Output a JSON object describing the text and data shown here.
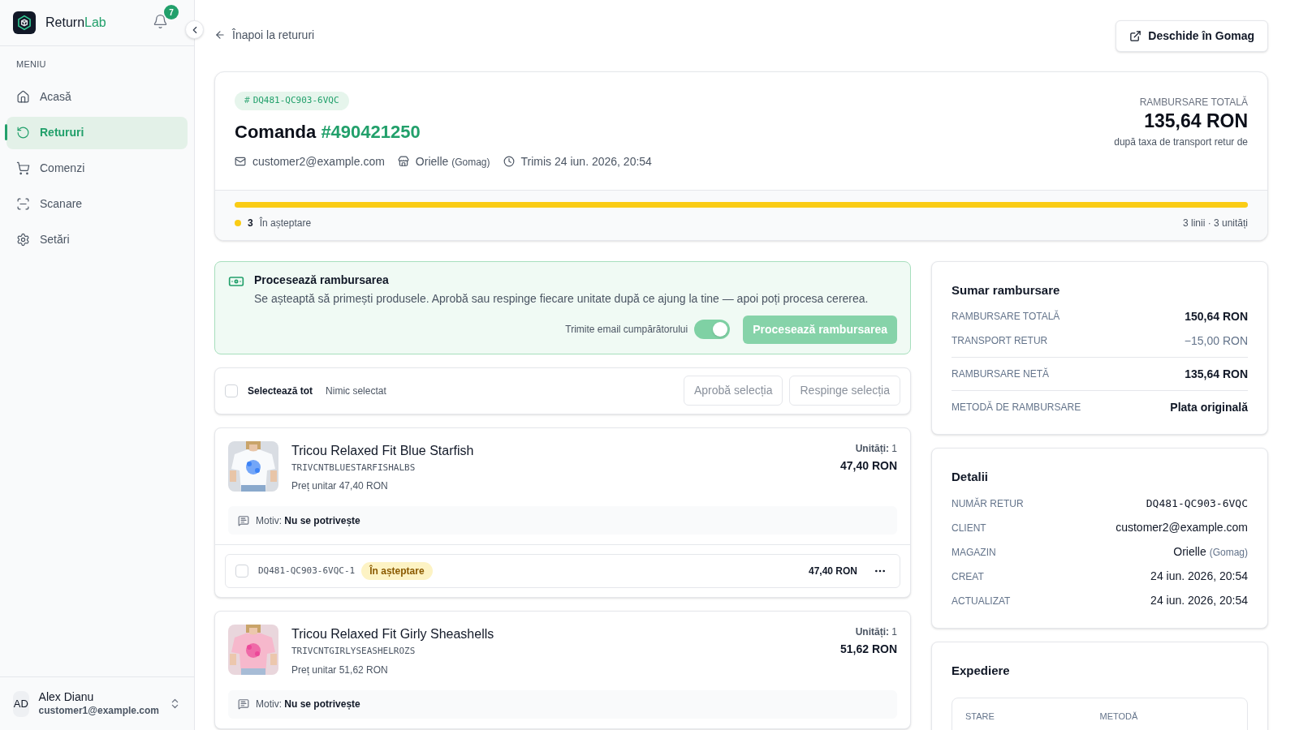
{
  "sidebar": {
    "brand": {
      "main": "Return",
      "accent": "Lab"
    },
    "notifications": {
      "count": "7"
    },
    "section_label": "MENIU",
    "items": [
      {
        "label": "Acasă",
        "selected": false
      },
      {
        "label": "Retururi",
        "selected": true
      },
      {
        "label": "Comenzi",
        "selected": false
      },
      {
        "label": "Scanare",
        "selected": false
      },
      {
        "label": "Setări",
        "selected": false
      }
    ],
    "user": {
      "initials": "AD",
      "name": "Alex Dianu",
      "email": "customer1@example.com"
    }
  },
  "header": {
    "back_link": "Înapoi la retururi",
    "open_button": "Deschide în Gomag"
  },
  "order": {
    "hash_sign": "#",
    "return_code": "DQ481-QC903-6VQC",
    "title_prefix": "Comanda",
    "order_number": "#490421250",
    "email": "customer2@example.com",
    "store": "Orielle",
    "platform": "(Gomag)",
    "sent": "Trimis 24 iun. 2026, 20:54",
    "total_label": "RAMBURSARE TOTALĂ",
    "total": "135,64 RON",
    "total_note": "după taxa de transport retur de",
    "progress": {
      "level": 1,
      "color": "#facc15"
    },
    "status_count": "3",
    "status_label": "În așteptare",
    "summary": "3 linii · 3 unități"
  },
  "process": {
    "title": "Procesează rambursarea",
    "description": "Se așteaptă să primești produsele. Aprobă sau respinge fiecare unitate după ce ajung la tine — apoi poți procesa cererea.",
    "email_toggle": {
      "label": "Trimite email cumpărătorului",
      "on": true
    },
    "button": {
      "label": "Procesează rambursarea",
      "disabled": true
    }
  },
  "selection": {
    "select_all": {
      "label": "Selectează tot",
      "checked": false
    },
    "status": "Nimic selectat",
    "buttons": [
      {
        "label": "Aprobă selecția",
        "disabled": true
      },
      {
        "label": "Respinge selecția",
        "disabled": true
      }
    ]
  },
  "items": [
    {
      "name": "Tricou Relaxed Fit Blue Starfish",
      "sku": "TRIVCNTBLUESTARFISHALBS",
      "unit_price": "Preț unitar 47,40 RON",
      "units_label": "Unități:",
      "units": "1",
      "total": "47,40 RON",
      "reason_label": "Motiv:",
      "reason": "Nu se potrivește",
      "kind": "picture",
      "unit_rows": [
        {
          "code": "DQ481-QC903-6VQC-1",
          "checked": false,
          "status": "În așteptare",
          "amount": "47,40 RON"
        }
      ]
    },
    {
      "name": "Tricou Relaxed Fit Girly Sheashells",
      "sku": "TRIVCNTGIRLYSEASHELROZS",
      "unit_price": "Preț unitar 51,62 RON",
      "units_label": "Unități:",
      "units": "1",
      "total": "51,62 RON",
      "reason_label": "Motiv:",
      "reason": "Nu se potrivește",
      "kind": "picture"
    }
  ],
  "refund_summary": {
    "title": "Sumar rambursare",
    "groups": [
      [
        {
          "label": "RAMBURSARE TOTALĂ",
          "value": "150,64 RON",
          "kind": "strong"
        },
        {
          "label": "TRANSPORT RETUR",
          "value": "−15,00 RON",
          "kind": "muted"
        }
      ],
      [
        {
          "label": "RAMBURSARE NETĂ",
          "value": "135,64 RON",
          "kind": "strong"
        }
      ],
      [
        {
          "label": "METODĂ DE RAMBURSARE",
          "value": "Plata originală",
          "kind": "strong"
        }
      ]
    ]
  },
  "details": {
    "title": "Detalii",
    "rows": [
      {
        "label": "NUMĂR RETUR",
        "value": "DQ481-QC903-6VQC",
        "kind": "mono"
      },
      {
        "label": "CLIENT",
        "value": "customer2@example.com",
        "kind": "text"
      },
      {
        "label": "MAGAZIN",
        "value": "Orielle",
        "note": "(Gomag)",
        "kind": "store"
      },
      {
        "label": "CREAT",
        "value": "24 iun. 2026, 20:54",
        "kind": "text"
      },
      {
        "label": "ACTUALIZAT",
        "value": "24 iun. 2026, 20:54",
        "kind": "text"
      }
    ]
  },
  "shipping": {
    "title": "Expediere",
    "columns": [
      "STARE",
      "METODĂ"
    ]
  }
}
